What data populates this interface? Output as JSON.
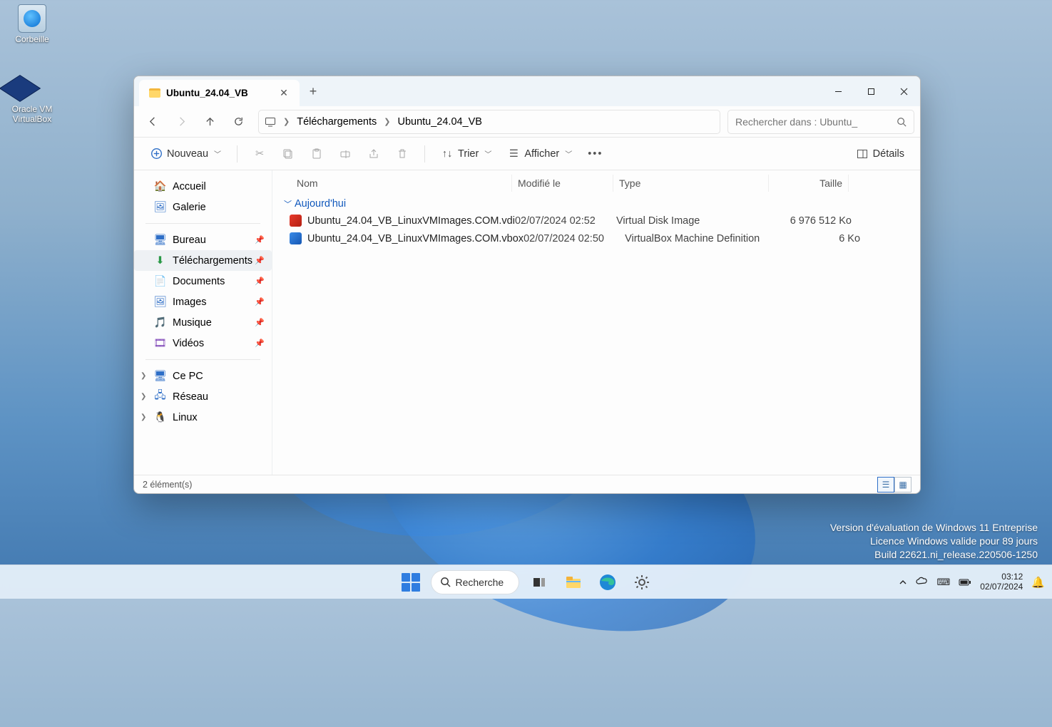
{
  "desktop": {
    "icons": [
      {
        "label": "Corbeille"
      },
      {
        "label": "Oracle VM VirtualBox"
      }
    ]
  },
  "explorer": {
    "tab_title": "Ubuntu_24.04_VB",
    "breadcrumbs": [
      "Téléchargements",
      "Ubuntu_24.04_VB"
    ],
    "search_placeholder": "Rechercher dans : Ubuntu_",
    "toolbar": {
      "new_label": "Nouveau",
      "sort_label": "Trier",
      "view_label": "Afficher",
      "details_label": "Détails"
    },
    "sidebar": {
      "home": "Accueil",
      "gallery": "Galerie",
      "desktop": "Bureau",
      "downloads": "Téléchargements",
      "documents": "Documents",
      "pictures": "Images",
      "music": "Musique",
      "videos": "Vidéos",
      "thispc": "Ce PC",
      "network": "Réseau",
      "linux": "Linux"
    },
    "columns": {
      "name": "Nom",
      "modified": "Modifié le",
      "type": "Type",
      "size": "Taille"
    },
    "group_label": "Aujourd'hui",
    "files": [
      {
        "name": "Ubuntu_24.04_VB_LinuxVMImages.COM.vdi",
        "modified": "02/07/2024 02:52",
        "type": "Virtual Disk Image",
        "size": "6 976 512 Ko",
        "icon": "vdi"
      },
      {
        "name": "Ubuntu_24.04_VB_LinuxVMImages.COM.vbox",
        "modified": "02/07/2024 02:50",
        "type": "VirtualBox Machine Definition",
        "size": "6 Ko",
        "icon": "vbox"
      }
    ],
    "status": "2 élément(s)"
  },
  "watermark": {
    "l1": "Version d'évaluation de Windows 11 Entreprise",
    "l2": "Licence Windows valide pour 89 jours",
    "l3": "Build 22621.ni_release.220506-1250"
  },
  "taskbar": {
    "search_label": "Recherche",
    "time": "03:12",
    "date": "02/07/2024"
  }
}
